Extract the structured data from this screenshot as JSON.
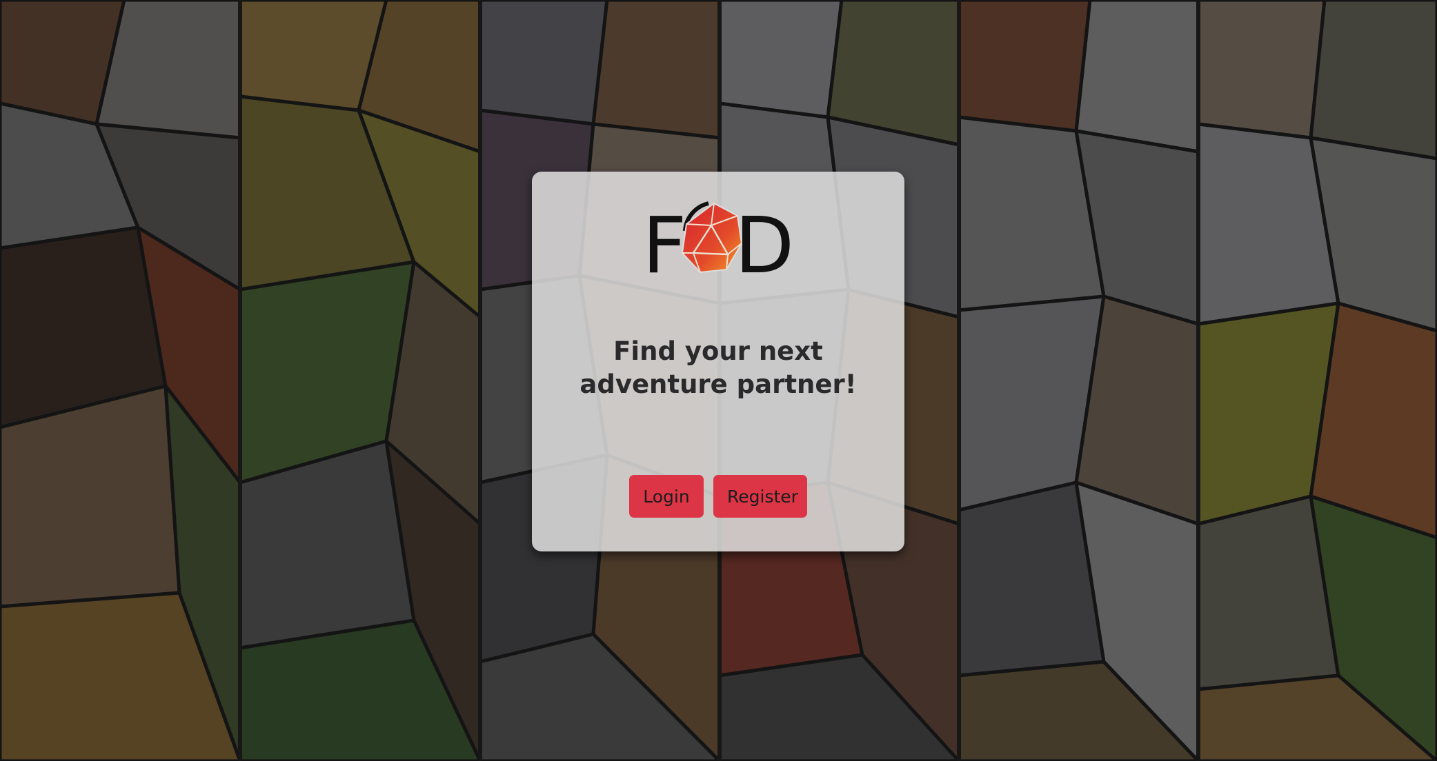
{
  "logo": {
    "text_left": "F",
    "text_right": "D"
  },
  "hero": {
    "headline": "Find your next adventure partner!"
  },
  "actions": {
    "login_label": "Login",
    "register_label": "Register"
  },
  "colors": {
    "accent": "#dc3545",
    "card": "#e1dfe0",
    "text": "#2a2a2c"
  },
  "icons": {
    "logo_die": "d20-dice-icon"
  }
}
